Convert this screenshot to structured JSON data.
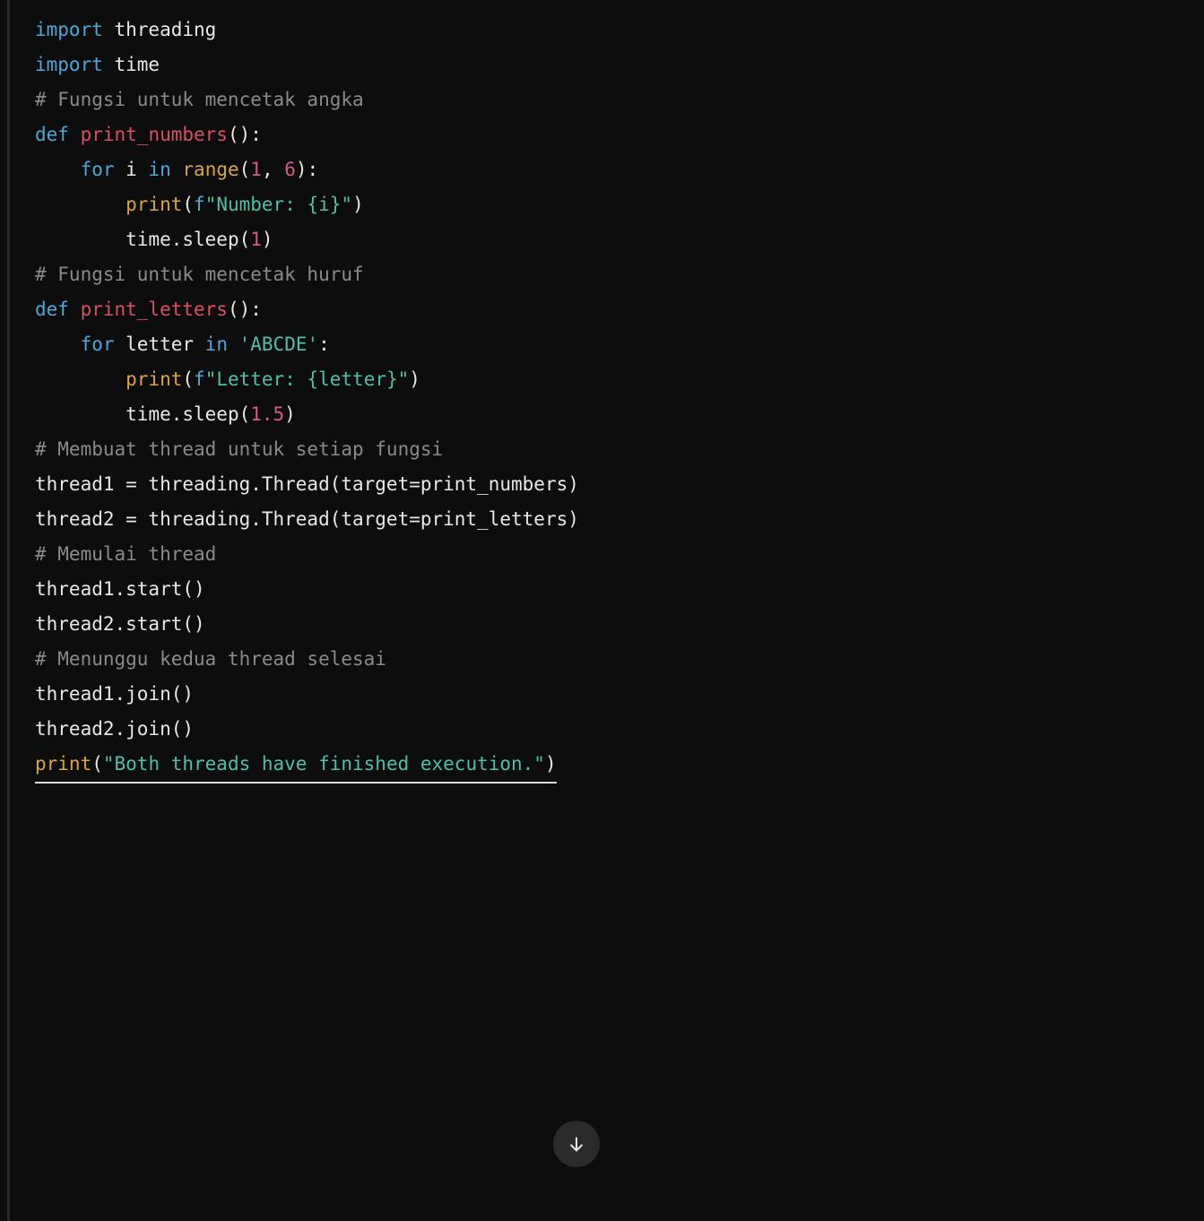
{
  "code": {
    "l1_import": "import",
    "l1_mod": " threading",
    "l2_import": "import",
    "l2_mod": " time",
    "blank": "",
    "l4_cmt": "# Fungsi untuk mencetak angka",
    "l5_def": "def",
    "l5_sp": " ",
    "l5_fn": "print_numbers",
    "l5_paren": "():",
    "l6_indent": "    ",
    "l6_for": "for",
    "l6_i": " i ",
    "l6_in": "in",
    "l6_sp": " ",
    "l6_range": "range",
    "l6_op": "(",
    "l6_n1": "1",
    "l6_comma": ", ",
    "l6_n2": "6",
    "l6_cl": "):",
    "l7_indent": "        ",
    "l7_print": "print",
    "l7_op": "(",
    "l7_f": "f",
    "l7_str": "\"Number: {i}\"",
    "l7_cl": ")",
    "l8_indent": "        ",
    "l8_time": "time.sleep(",
    "l8_n": "1",
    "l8_cl": ")",
    "l10_cmt": "# Fungsi untuk mencetak huruf",
    "l11_def": "def",
    "l11_sp": " ",
    "l11_fn": "print_letters",
    "l11_paren": "():",
    "l12_indent": "    ",
    "l12_for": "for",
    "l12_letter": " letter ",
    "l12_in": "in",
    "l12_sp": " ",
    "l12_str": "'ABCDE'",
    "l12_cl": ":",
    "l13_indent": "        ",
    "l13_print": "print",
    "l13_op": "(",
    "l13_f": "f",
    "l13_str": "\"Letter: {letter}\"",
    "l13_cl": ")",
    "l14_indent": "        ",
    "l14_time": "time.sleep(",
    "l14_n": "1.5",
    "l14_cl": ")",
    "l16_cmt": "# Membuat thread untuk setiap fungsi",
    "l17": "thread1 = threading.Thread(target=print_numbers)",
    "l18": "thread2 = threading.Thread(target=print_letters)",
    "l20_cmt": "# Memulai thread",
    "l21": "thread1.start()",
    "l22": "thread2.start()",
    "l24_cmt": "# Menunggu kedua thread selesai",
    "l25": "thread1.join()",
    "l26": "thread2.join()",
    "l28_print": "print",
    "l28_op": "(",
    "l28_str": "\"Both threads have finished execution.\"",
    "l28_cl": ")"
  },
  "icons": {
    "scroll_down": "arrow-down"
  }
}
